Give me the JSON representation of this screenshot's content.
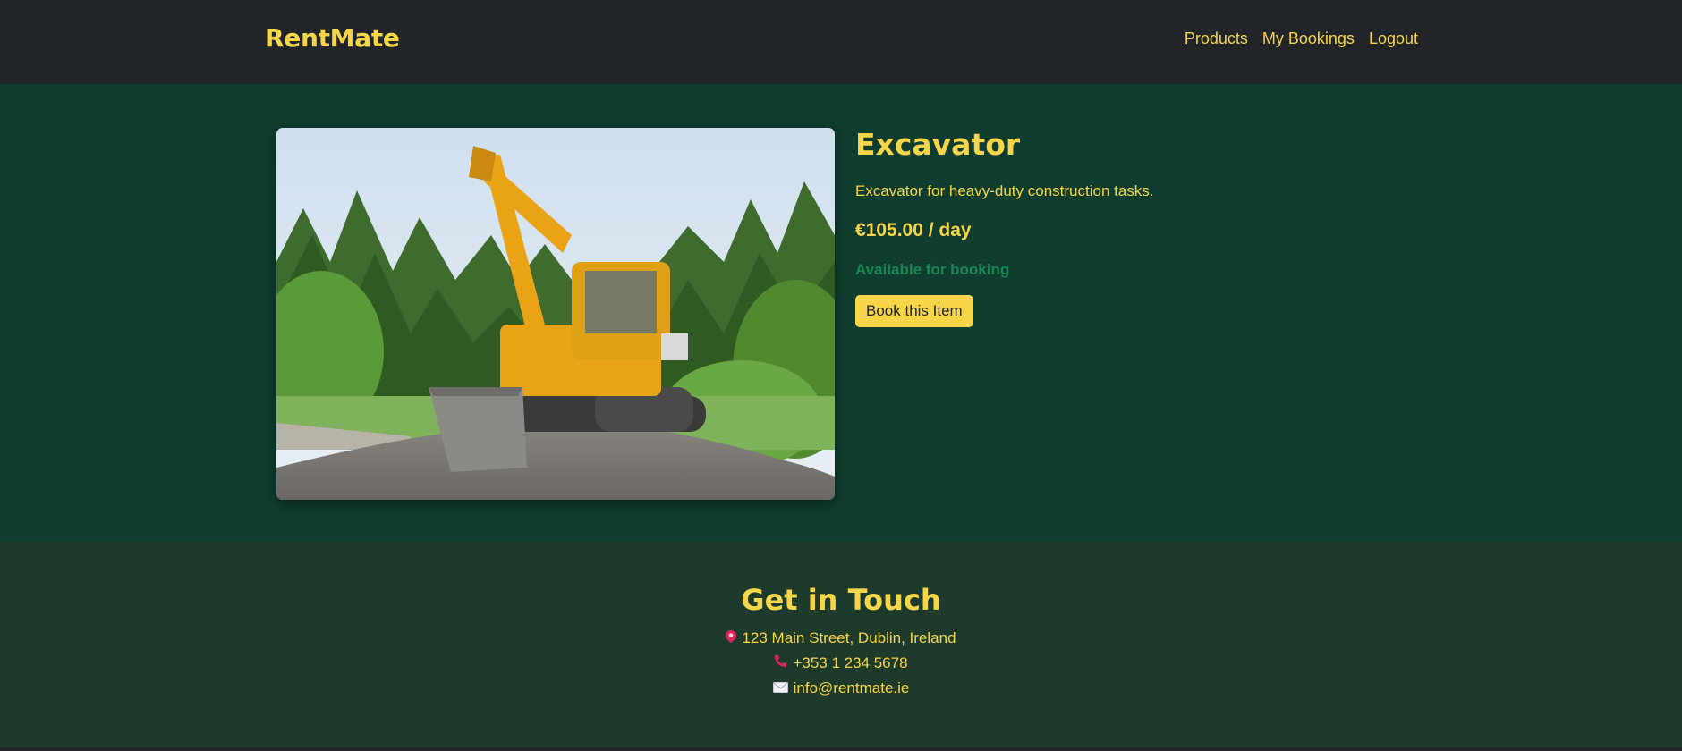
{
  "navbar": {
    "brand": "RentMate",
    "links": [
      "Products",
      "My Bookings",
      "Logout"
    ]
  },
  "product": {
    "title": "Excavator",
    "description": "Excavator for heavy-duty construction tasks.",
    "price": "€105.00 / day",
    "availability": "Available for booking",
    "book_label": "Book this Item",
    "image_icon": "excavator-photo"
  },
  "footer": {
    "title": "Get in Touch",
    "address": "123 Main Street, Dublin, Ireland",
    "phone": "+353 1 234 5678",
    "email": "info@rentmate.ie",
    "address_icon": "pin-icon",
    "phone_icon": "phone-icon",
    "email_icon": "envelope-icon"
  },
  "colors": {
    "accent": "#f7d548",
    "navbar_bg": "#212529",
    "main_bg": "#0f3d2f",
    "footer_bg": "#1e3a2a",
    "available": "#198754"
  }
}
